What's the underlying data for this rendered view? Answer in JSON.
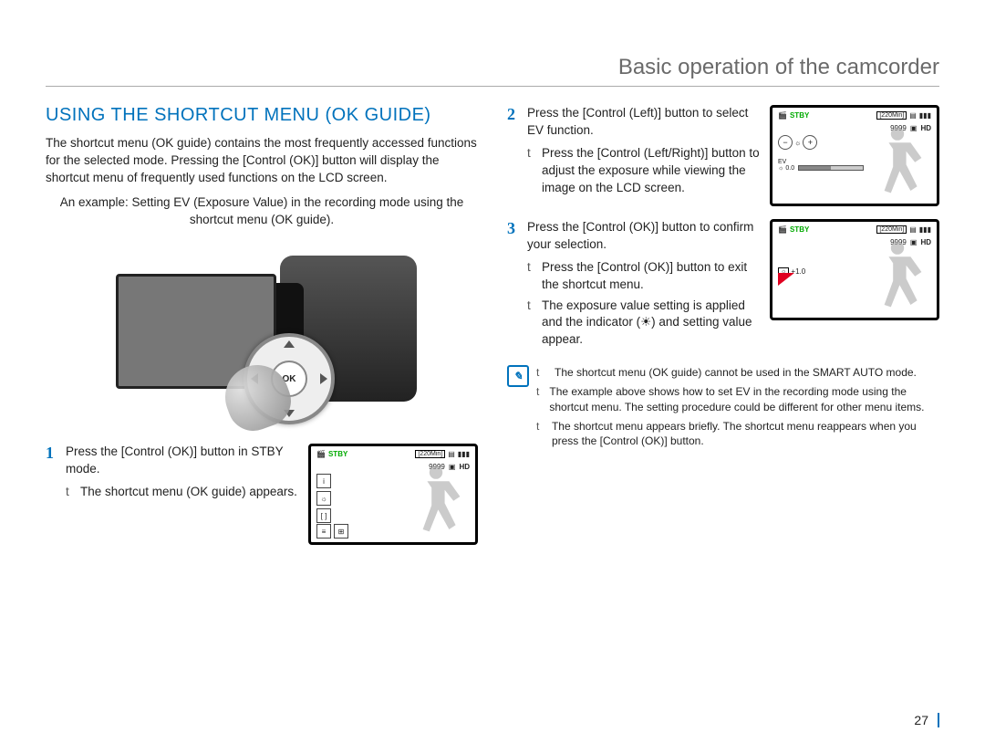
{
  "chapter_title": "Basic operation of the camcorder",
  "heading": "USING THE SHORTCUT MENU (OK GUIDE)",
  "intro": "The shortcut menu (OK guide) contains the most frequently accessed functions for the selected mode. Pressing the [Control (OK)] button will display the shortcut menu of frequently used functions on the LCD screen.",
  "example_line": "An example: Setting EV (Exposure Value) in the recording mode using the shortcut menu (OK guide).",
  "ok_label": "OK",
  "steps": {
    "s1": {
      "num": "1",
      "text": "Press the [Control (OK)] button in STBY mode.",
      "sub1": "The shortcut menu (OK guide) appears."
    },
    "s2": {
      "num": "2",
      "text": "Press the [Control (Left)] button to select EV function.",
      "sub1": "Press the [Control (Left/Right)] button to adjust the exposure while viewing the image on the LCD screen."
    },
    "s3": {
      "num": "3",
      "text": "Press the [Control (OK)] button to confirm your selection.",
      "sub1": "Press the [Control (OK)] button to exit the shortcut menu.",
      "sub2": "The exposure value setting is applied and the indicator (☀) and setting value appear."
    }
  },
  "bullet": "t",
  "lcd": {
    "stby": "STBY",
    "time": "[220Min]",
    "count": "9999",
    "hd": "HD",
    "ev_label": "EV",
    "ev_val_zero": "0.0",
    "ev_val_plus": "+1.0",
    "memory": "▣"
  },
  "notes": {
    "n1": "The shortcut menu (OK guide) cannot be used in the SMART AUTO mode.",
    "n2": "The example above shows how to set EV in the recording mode using the shortcut menu. The setting procedure could be different for other menu items.",
    "n3": "The shortcut menu appears briefly. The shortcut menu reappears when you press the [Control (OK)] button."
  },
  "page_number": "27"
}
